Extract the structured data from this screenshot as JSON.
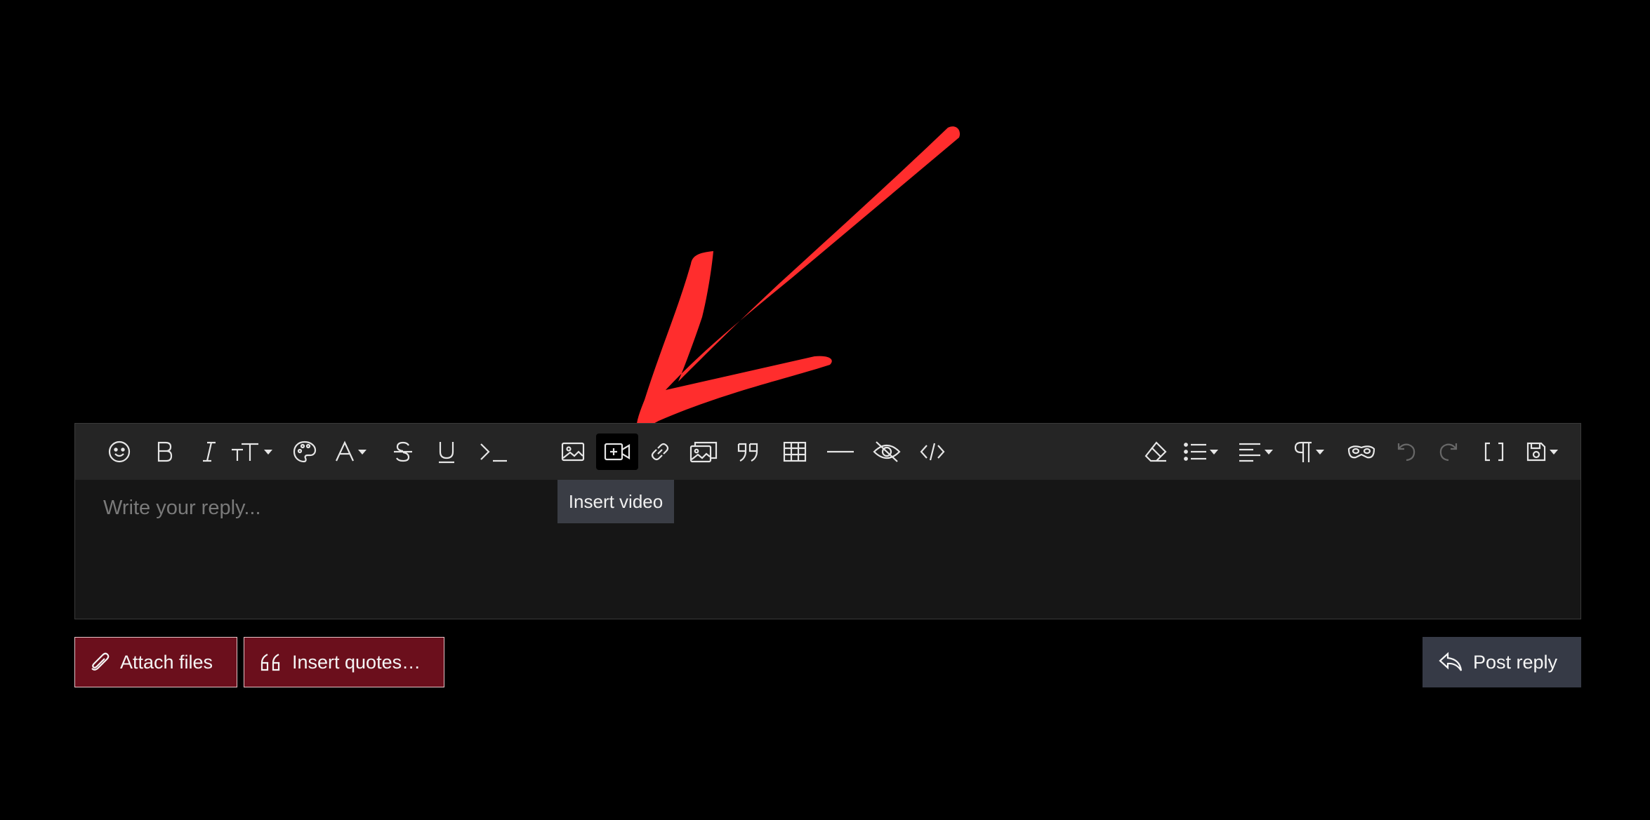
{
  "editor": {
    "placeholder": "Write your reply...",
    "tooltip": "Insert video"
  },
  "buttons": {
    "attach_files": "Attach files",
    "insert_quotes": "Insert quotes…",
    "post_reply": "Post reply"
  },
  "colors": {
    "annotation_arrow": "#ff2d2d",
    "secondary_button": "#6b0f1c",
    "primary_button": "#363a46"
  }
}
